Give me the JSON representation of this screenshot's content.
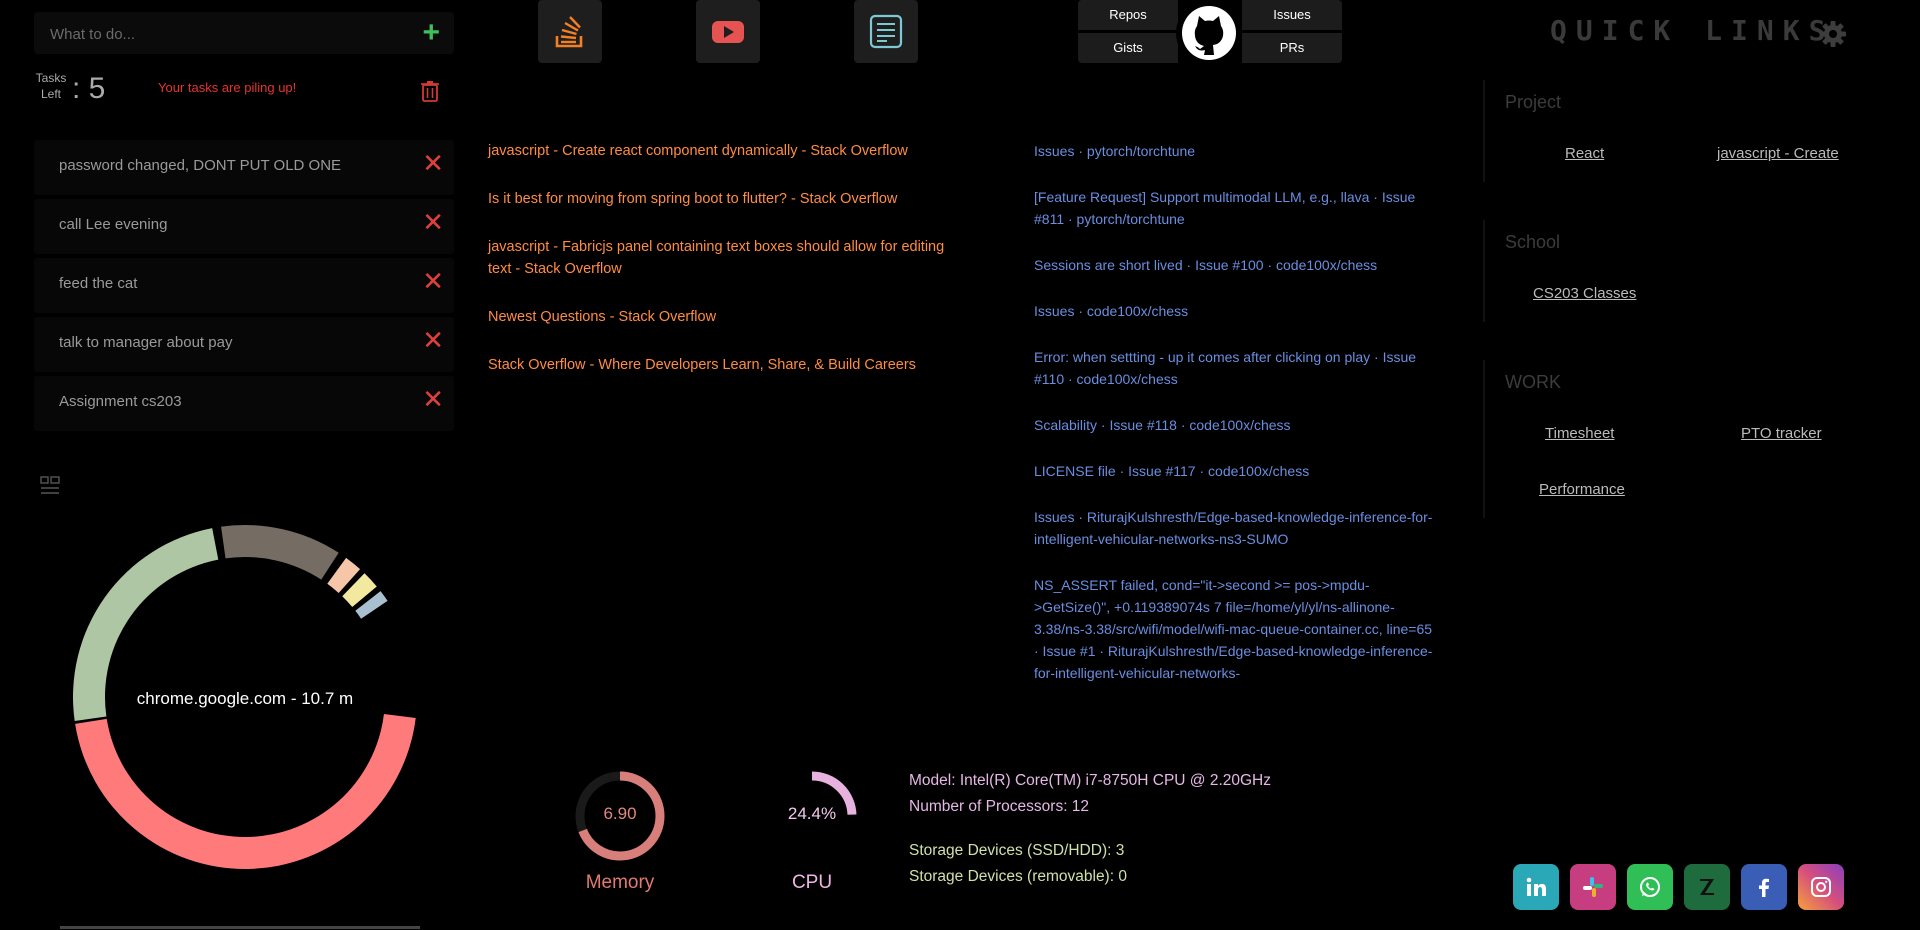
{
  "todo": {
    "placeholder": "What to do...",
    "add_icon": "+",
    "tasks_left_label_1": "Tasks",
    "tasks_left_label_2": "Left",
    "tasks_left_count": ": 5",
    "warning": "Your tasks are piling up!",
    "items": [
      {
        "text": "password changed, DONT PUT OLD ONE"
      },
      {
        "text": "call Lee evening"
      },
      {
        "text": "feed the cat"
      },
      {
        "text": "talk to manager about pay"
      },
      {
        "text": "Assignment cs203"
      }
    ],
    "delete_glyph": "✕"
  },
  "usage_chart": {
    "center_label": "chrome.google.com - 10.7 m",
    "colors": [
      "#ff7b7b",
      "#aec6a4",
      "#756c63",
      "#f5c6a8",
      "#f3e8a0",
      "#a9c0d0"
    ]
  },
  "top_icons": {
    "stackoverflow": "stackoverflow-icon",
    "youtube": "youtube-icon",
    "notes": "notes-icon"
  },
  "github": {
    "repos": "Repos",
    "issues": "Issues",
    "gists": "Gists",
    "prs": "PRs"
  },
  "quick_links_title": "QUICK LINKS",
  "stackoverflow_links": [
    "javascript - Create react component dynamically - Stack Overflow",
    "Is it best for moving from spring boot to flutter? - Stack Overflow",
    "javascript - Fabricjs panel containing text boxes should allow for editing text - Stack Overflow",
    "Newest Questions - Stack Overflow",
    "Stack Overflow - Where Developers Learn, Share, & Build Careers"
  ],
  "github_links": [
    "Issues · pytorch/torchtune",
    "[Feature Request] Support multimodal LLM, e.g., llava · Issue #811 · pytorch/torchtune",
    "Sessions are short lived · Issue #100 · code100x/chess",
    "Issues · code100x/chess",
    "Error: when settting - up it comes after clicking on play · Issue #110 · code100x/chess",
    "Scalability · Issue #118 · code100x/chess",
    "LICENSE file · Issue #117 · code100x/chess",
    "Issues · RiturajKulshresth/Edge-based-knowledge-inference-for-intelligent-vehicular-networks-ns3-SUMO",
    "NS_ASSERT failed, cond=\"it->second >= pos->mpdu->GetSize()\", +0.119389074s 7 file=/home/yl/yl/ns-allinone-3.38/ns-3.38/src/wifi/model/wifi-mac-queue-container.cc, line=65 · Issue #1 · RiturajKulshresth/Edge-based-knowledge-inference-for-intelligent-vehicular-networks-"
  ],
  "quick_links": {
    "project": {
      "heading": "Project",
      "links": [
        "React",
        "javascript - Create"
      ]
    },
    "school": {
      "heading": "School",
      "links": [
        "CS203 Classes"
      ]
    },
    "work": {
      "heading": "WORK",
      "links": [
        "Timesheet",
        "PTO tracker",
        "Performance"
      ]
    }
  },
  "system": {
    "memory_value": "6.90",
    "memory_label": "Memory",
    "memory_fraction": 0.69,
    "cpu_value": "24.4%",
    "cpu_label": "CPU",
    "cpu_fraction": 0.244,
    "model": "Model: Intel(R) Core(TM) i7-8750H CPU @ 2.20GHz",
    "processors": "Number of Processors: 12",
    "storage_ssd": "Storage Devices (SSD/HDD): 3",
    "storage_removable": "Storage Devices (removable): 0"
  },
  "social": [
    {
      "name": "linkedin-icon",
      "color": "#2aa8b8"
    },
    {
      "name": "slack-icon",
      "color": "#c63e7f"
    },
    {
      "name": "whatsapp-icon",
      "color": "#2fbf56"
    },
    {
      "name": "zotero-icon",
      "color": "#1e6b3e"
    },
    {
      "name": "facebook-icon",
      "color": "#3a5eb6"
    },
    {
      "name": "instagram-icon",
      "color": "#d64f7d"
    }
  ]
}
